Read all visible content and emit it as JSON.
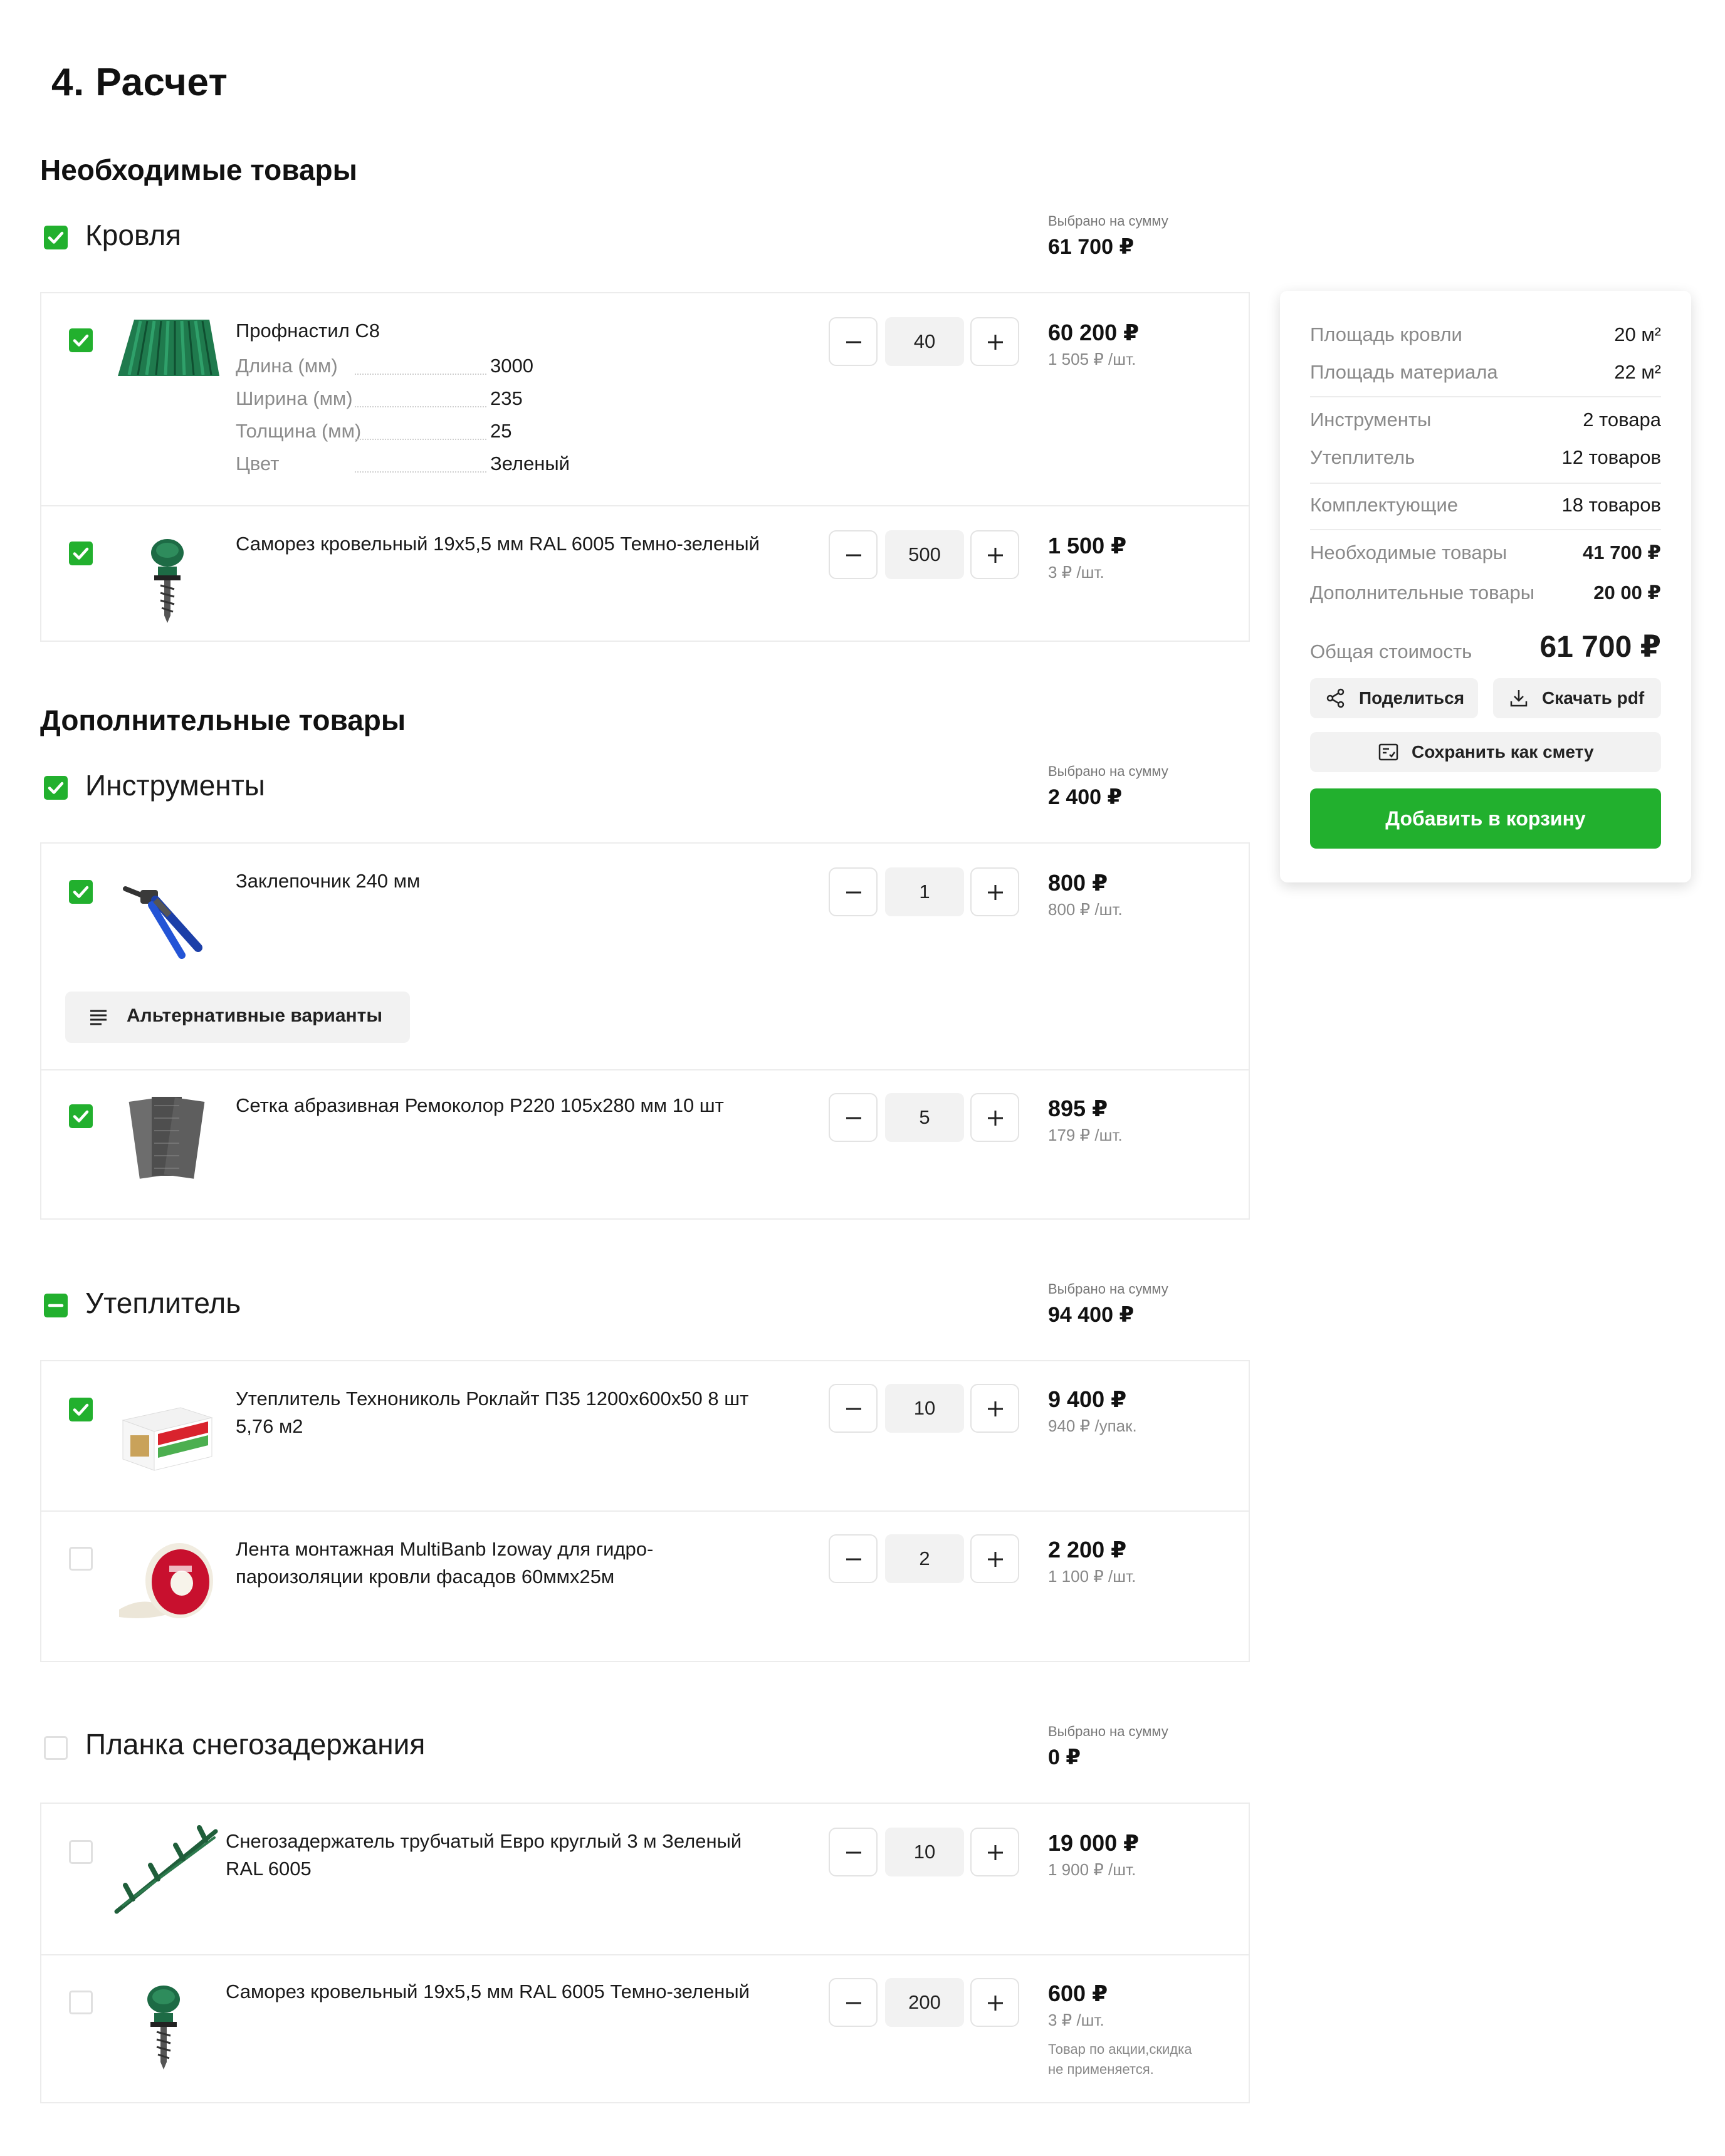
{
  "title": "4. Расчет",
  "required_heading": "Необходимые товары",
  "additional_heading": "Дополнительные товары",
  "sum_label": "Выбрано на сумму",
  "groups": [
    {
      "name": "Кровля",
      "sum": "61 700 ₽",
      "state": "checked",
      "items": [
        {
          "name": "Профнастил С8",
          "qty": "40",
          "price": "60 200 ₽",
          "unit": "1 505 ₽ /шт.",
          "checked": true,
          "specs": [
            {
              "k": "Длина (мм)",
              "v": "3000"
            },
            {
              "k": "Ширина (мм)",
              "v": "235"
            },
            {
              "k": "Толщина (мм)",
              "v": "25"
            },
            {
              "k": "Цвет",
              "v": "Зеленый"
            }
          ]
        },
        {
          "name": "Саморез кровельный 19х5,5 мм RAL 6005 Темно-зеленый",
          "qty": "500",
          "price": "1 500 ₽",
          "unit": "3 ₽ /шт.",
          "checked": true
        }
      ]
    },
    {
      "name": "Инструменты",
      "sum": "2 400 ₽",
      "state": "checked",
      "items": [
        {
          "name": "Заклепочник 240 мм",
          "qty": "1",
          "price": "800 ₽",
          "unit": "800 ₽ /шт.",
          "checked": true,
          "alt_label": "Альтернативные варианты"
        },
        {
          "name": "Сетка абразивная Ремоколор Р220 105х280 мм 10 шт",
          "qty": "5",
          "price": "895 ₽",
          "unit": "179 ₽ /шт.",
          "checked": true
        }
      ]
    },
    {
      "name": "Утеплитель",
      "sum": "94 400 ₽",
      "state": "partial",
      "items": [
        {
          "name_lines": [
            "Утеплитель Технониколь Роклайт П35 1200х600х50 8 шт",
            "5,76 м2"
          ],
          "qty": "10",
          "price": "9 400 ₽",
          "unit": "940 ₽ /упак.",
          "checked": true
        },
        {
          "name_lines": [
            "Лента монтажная MultiBanb Izoway для гидро-",
            "пароизоляции кровли фасадов 60ммх25м"
          ],
          "qty": "2",
          "price": "2 200 ₽",
          "unit": "1 100 ₽ /шт.",
          "checked": false
        }
      ]
    },
    {
      "name": "Планка снегозадержания",
      "sum": "0 ₽",
      "state": "unchecked",
      "items": [
        {
          "name_lines": [
            "Снегозадержатель трубчатый Евро круглый 3 м Зеленый",
            "RAL 6005"
          ],
          "qty": "10",
          "price": "19 000 ₽",
          "unit": "1 900 ₽ /шт.",
          "checked": false
        },
        {
          "name": "Саморез кровельный 19х5,5 мм RAL 6005 Темно-зеленый",
          "qty": "200",
          "price": "600 ₽",
          "unit": "3 ₽ /шт.",
          "checked": false,
          "note_lines": [
            "Товар по акции,скидка",
            "не применяется."
          ]
        }
      ]
    }
  ],
  "summary": {
    "rows": [
      {
        "label": "Площадь кровли",
        "value": "20 м²"
      },
      {
        "label": "Площадь материала",
        "value": "22 м²"
      },
      {
        "label": "Инструменты",
        "value": "2 товара"
      },
      {
        "label": "Утеплитель",
        "value": "12 товаров"
      },
      {
        "label": "Комплектующие",
        "value": "18 товаров"
      },
      {
        "label": "Необходимые товары",
        "value": "41 700 ₽"
      },
      {
        "label": "Дополнительные товары",
        "value": "20 00 ₽"
      }
    ],
    "total_label": "Общая стоимость",
    "total_value": "61 700 ₽",
    "share_label": "Поделиться",
    "pdf_label": "Скачать pdf",
    "save_label": "Сохранить как смету",
    "cart_label": "Добавить в корзину"
  },
  "colors": {
    "accent": "#22b02e",
    "border": "#ececec",
    "muted": "#888888"
  },
  "icons": [
    "check-icon",
    "minus-icon",
    "plus-icon",
    "share-icon",
    "download-icon",
    "estimate-icon",
    "list-icon"
  ]
}
